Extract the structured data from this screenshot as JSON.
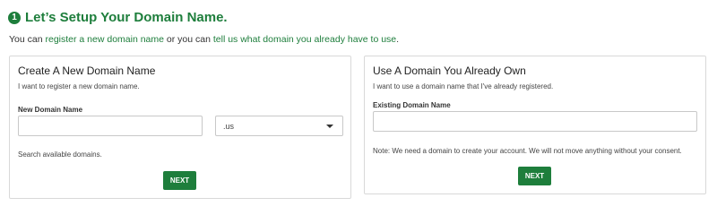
{
  "header": {
    "step_number": "1",
    "title": "Let’s Setup Your Domain Name."
  },
  "intro": {
    "prefix": "You can ",
    "link_register": "register a new domain name",
    "middle": " or you can ",
    "link_existing": "tell us what domain you already have to use",
    "suffix": "."
  },
  "new_domain": {
    "title": "Create A New Domain Name",
    "subtitle": "I want to register a new domain name.",
    "field_label": "New Domain Name",
    "input_value": "",
    "tld_selected": ".us",
    "helper": "Search available domains.",
    "next_label": "NEXT"
  },
  "existing_domain": {
    "title": "Use A Domain You Already Own",
    "subtitle": "I want to use a domain name that I've already registered.",
    "field_label": "Existing Domain Name",
    "input_value": "",
    "note": "Note: We need a domain to create your account. We will not move anything without your consent.",
    "next_label": "NEXT"
  },
  "colors": {
    "accent": "#1e7e3c",
    "border": "#d9d9d9"
  }
}
